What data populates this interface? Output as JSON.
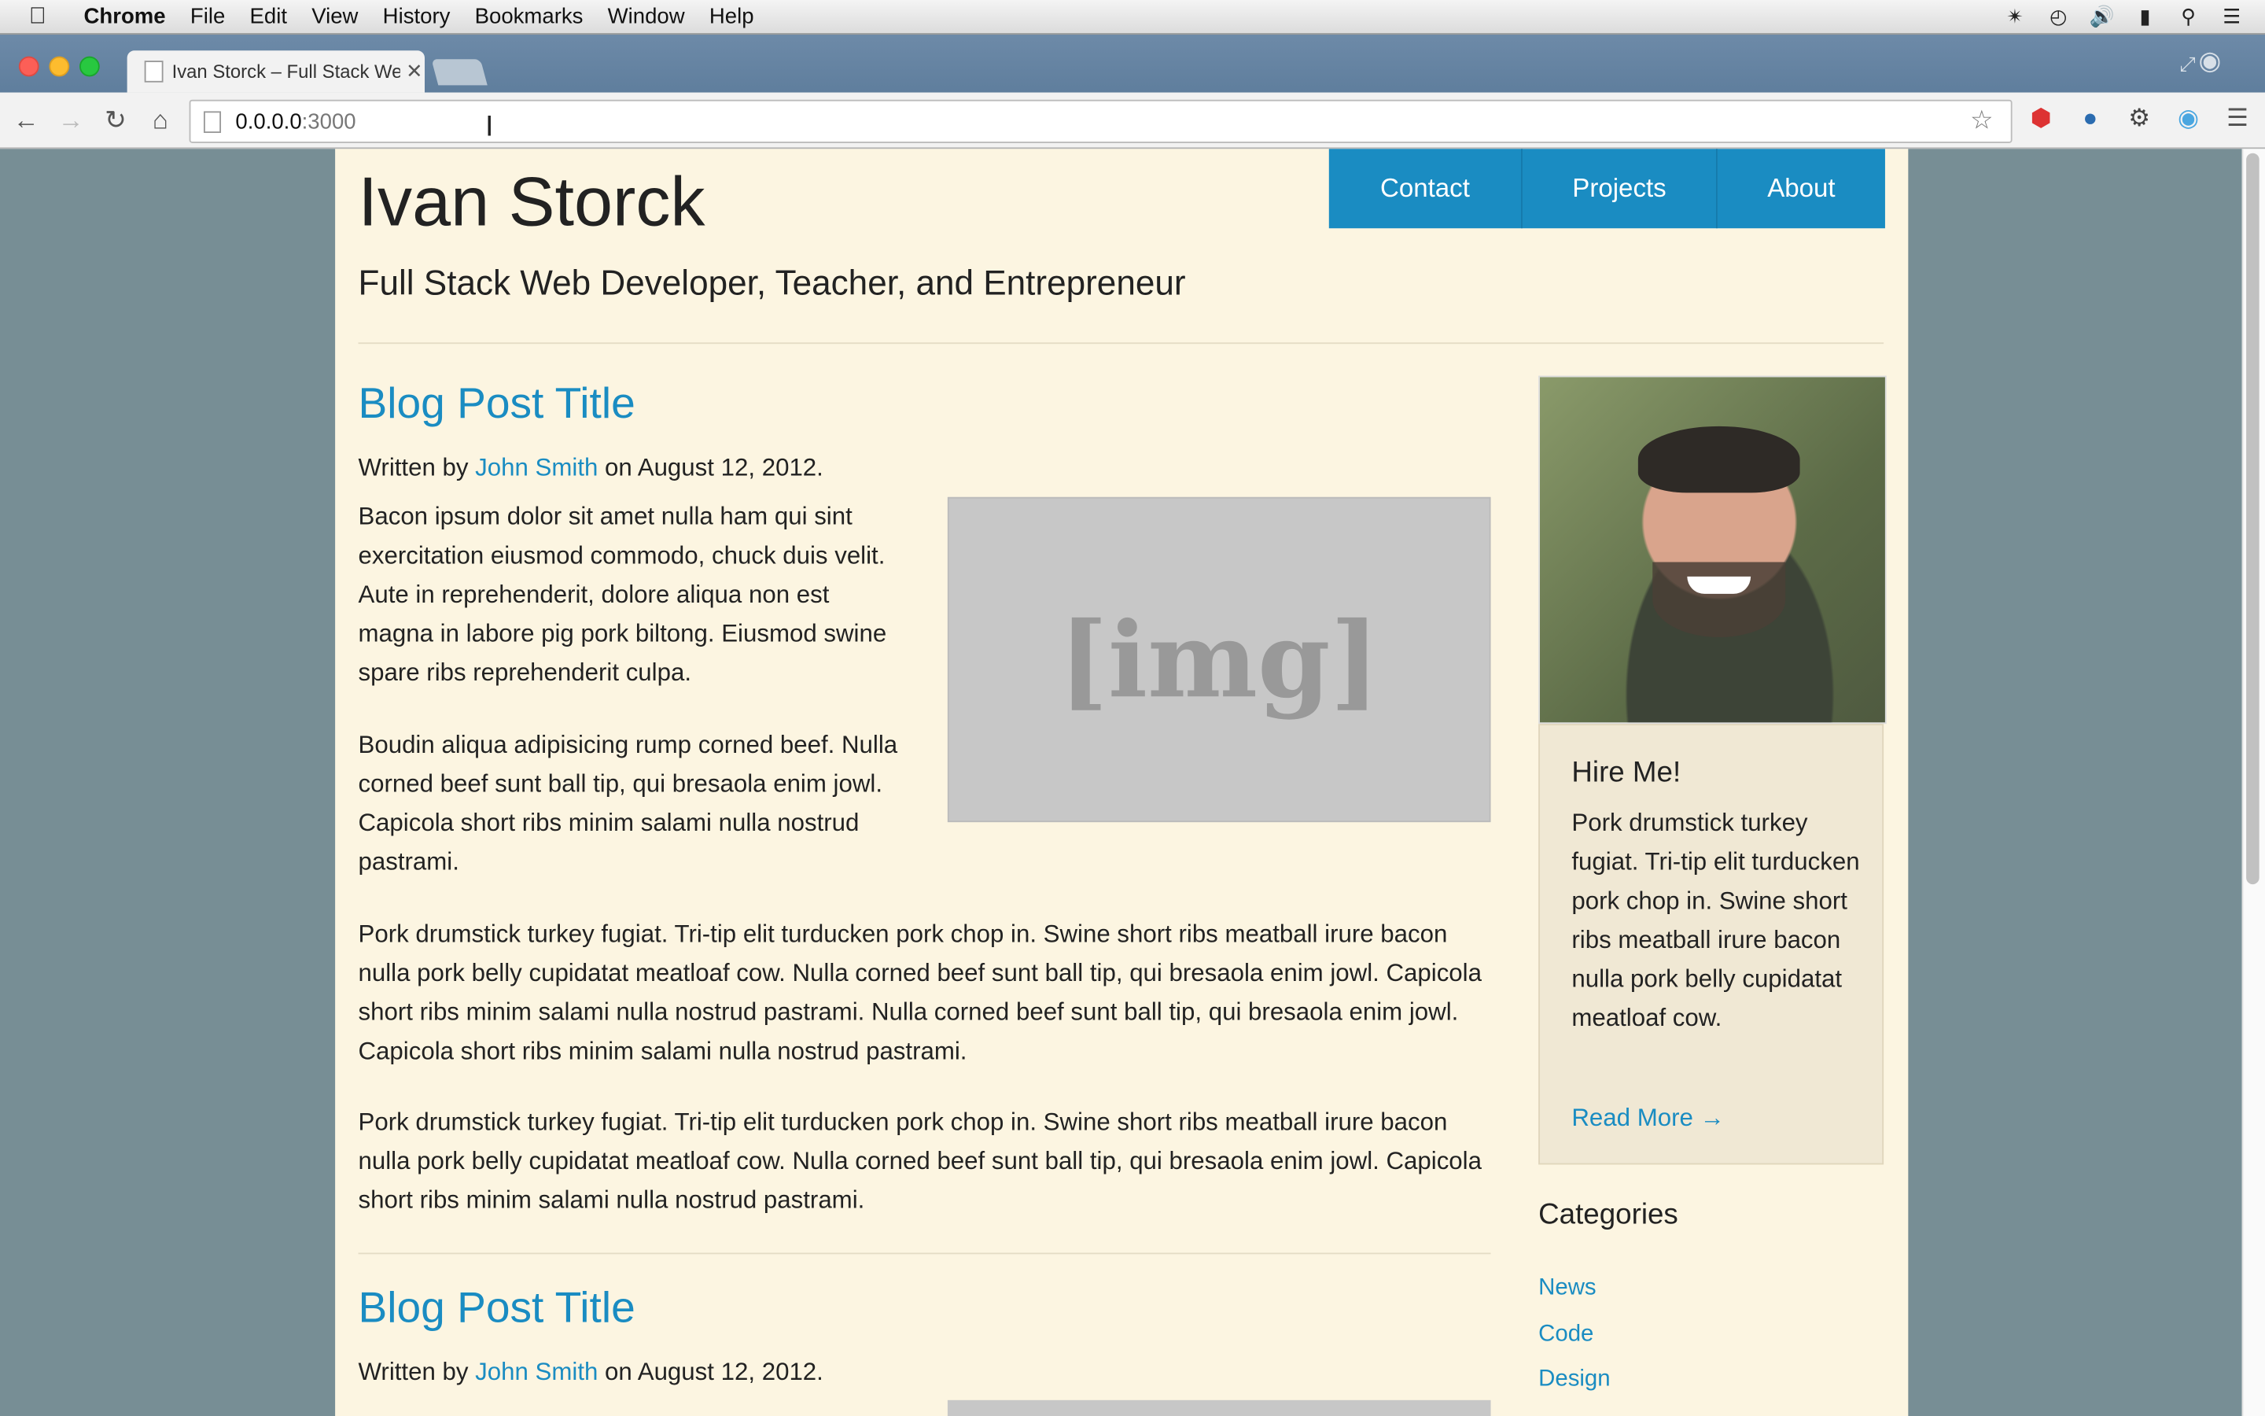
{
  "menubar": {
    "app": "Chrome",
    "items": [
      "File",
      "Edit",
      "View",
      "History",
      "Bookmarks",
      "Window",
      "Help"
    ]
  },
  "browser": {
    "tab_title": "Ivan Storck – Full Stack We",
    "url_host": "0.0.0.0",
    "url_port": ":3000"
  },
  "site": {
    "title": "Ivan Storck",
    "tagline": "Full Stack Web Developer, Teacher, and Entrepreneur",
    "nav": [
      "Contact",
      "Projects",
      "About"
    ]
  },
  "posts": [
    {
      "title": "Blog Post Title",
      "byline_prefix": "Written by ",
      "author": "John Smith",
      "byline_suffix": " on August 12, 2012.",
      "image_placeholder": "[img]",
      "paragraphs": [
        "Bacon ipsum dolor sit amet nulla ham qui sint exercitation eiusmod commodo, chuck duis velit. Aute in reprehenderit, dolore aliqua non est magna in labore pig pork biltong. Eiusmod swine spare ribs reprehenderit culpa.",
        "Boudin aliqua adipisicing rump corned beef. Nulla corned beef sunt ball tip, qui bresaola enim jowl. Capicola short ribs minim salami nulla nostrud pastrami.",
        "Pork drumstick turkey fugiat. Tri-tip elit turducken pork chop in. Swine short ribs meatball irure bacon nulla pork belly cupidatat meatloaf cow. Nulla corned beef sunt ball tip, qui bresaola enim jowl. Capicola short ribs minim salami nulla nostrud pastrami. Nulla corned beef sunt ball tip, qui bresaola enim jowl. Capicola short ribs minim salami nulla nostrud pastrami.",
        "Pork drumstick turkey fugiat. Tri-tip elit turducken pork chop in. Swine short ribs meatball irure bacon nulla pork belly cupidatat meatloaf cow. Nulla corned beef sunt ball tip, qui bresaola enim jowl. Capicola short ribs minim salami nulla nostrud pastrami."
      ]
    },
    {
      "title": "Blog Post Title",
      "byline_prefix": "Written by ",
      "author": "John Smith",
      "byline_suffix": " on August 12, 2012."
    }
  ],
  "sidebar": {
    "hire_title": "Hire Me!",
    "hire_text": "Pork drumstick turkey fugiat. Tri-tip elit turducken pork chop in. Swine short ribs meatball irure bacon nulla pork belly cupidatat meatloaf cow.",
    "read_more": "Read More →",
    "categories_title": "Categories",
    "categories": [
      "News",
      "Code",
      "Design"
    ]
  },
  "colors": {
    "accent": "#1a8cc2",
    "page_bg": "#fcf5e1",
    "outer_bg": "#778e95"
  }
}
